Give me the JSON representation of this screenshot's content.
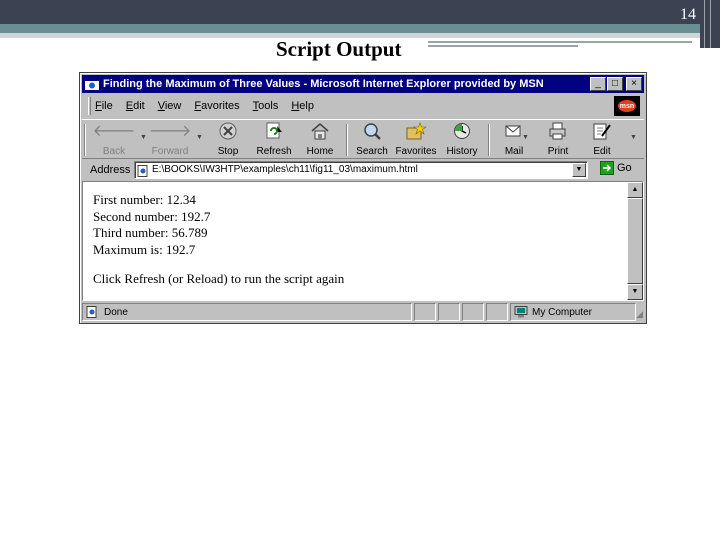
{
  "slide": {
    "page_number": "14",
    "title": "Script Output"
  },
  "window": {
    "title": "Finding the Maximum of Three Values - Microsoft Internet Explorer provided by MSN",
    "buttons": {
      "minimize": "_",
      "maximize": "□",
      "close": "×"
    }
  },
  "menu": {
    "items": [
      "File",
      "Edit",
      "View",
      "Favorites",
      "Tools",
      "Help"
    ],
    "logo_text": "msn"
  },
  "toolbar": {
    "back": "Back",
    "forward": "Forward",
    "stop": "Stop",
    "refresh": "Refresh",
    "home": "Home",
    "search": "Search",
    "favorites": "Favorites",
    "history": "History",
    "mail": "Mail",
    "print": "Print",
    "edit": "Edit"
  },
  "address": {
    "label": "Address",
    "value": "E:\\BOOKS\\IW3HTP\\examples\\ch11\\fig11_03\\maximum.html",
    "go": "Go"
  },
  "page": {
    "line1": "First number: 12.34",
    "line2": "Second number: 192.7",
    "line3": "Third number: 56.789",
    "line4": "Maximum is: 192.7",
    "line5": "Click Refresh (or Reload) to run the script again"
  },
  "status": {
    "text": "Done",
    "zone": "My Computer"
  }
}
